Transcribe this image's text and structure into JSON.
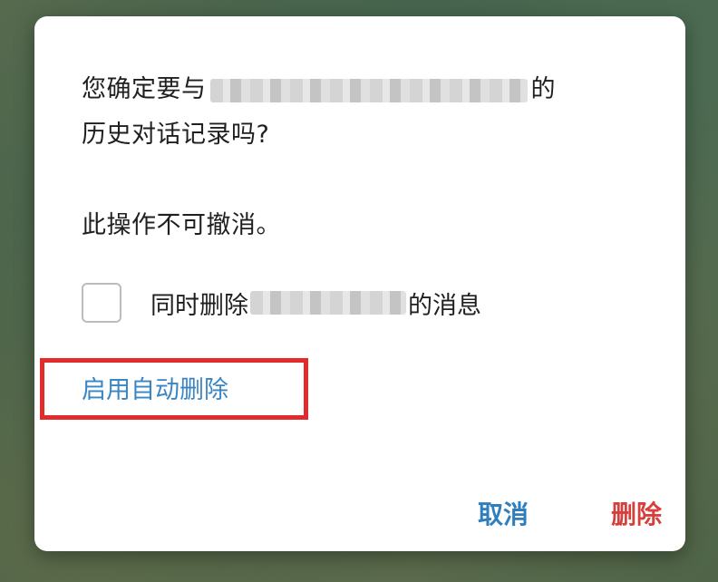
{
  "dialog": {
    "message_line1_prefix": "您确定要与",
    "message_line1_suffix": "的",
    "message_line2": "历史对话记录吗?",
    "warning": "此操作不可撤消。",
    "checkbox": {
      "checked": false,
      "label_prefix": "同时删除",
      "label_suffix": "的消息"
    },
    "auto_delete_link": "启用自动删除",
    "buttons": {
      "cancel": "取消",
      "delete": "删除"
    }
  },
  "colors": {
    "link": "#3a86c4",
    "cancel": "#2f7fbf",
    "delete": "#d6403c",
    "highlight": "#e22b2b"
  }
}
